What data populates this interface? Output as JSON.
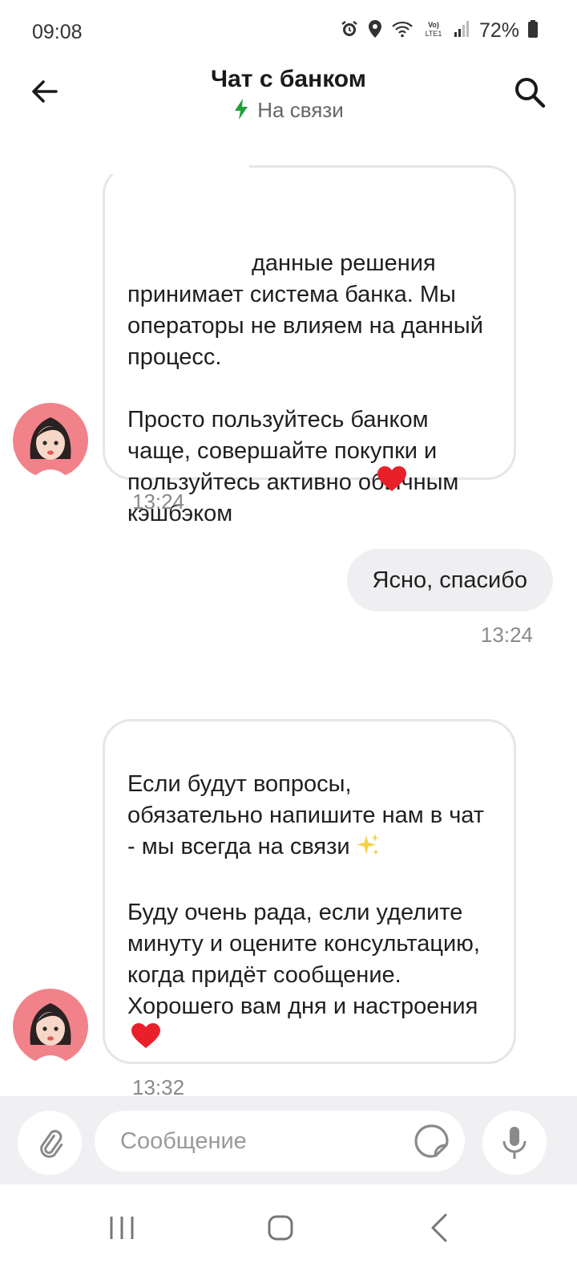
{
  "status_bar": {
    "time": "09:08",
    "network_label": "Vo) LTE1",
    "battery_percent": "72%",
    "icons": [
      "alarm-icon",
      "location-icon",
      "wifi-icon",
      "volte-icon",
      "signal-icon",
      "battery-icon"
    ]
  },
  "header": {
    "title": "Чат с банком",
    "status": "На связи",
    "status_color": "#21a038",
    "icons": [
      "arrow-back-icon",
      "search-icon",
      "bolt-icon"
    ]
  },
  "messages": [
    {
      "direction": "incoming",
      "text": "данные решения принимает система банка. Мы операторы не влияем на данный процесс.\n\nПросто пользуйтесь банком чаще, совершайте покупки и пользуйтесь активно обычным кэшбэком",
      "emoji": "heart-icon",
      "time": "13:24"
    },
    {
      "direction": "outgoing",
      "text": "Ясно, спасибо",
      "time": "13:24"
    },
    {
      "direction": "incoming",
      "text_part1": "Если будут вопросы, обязательно напишите нам в чат - мы всегда на связи",
      "emoji1": "sparkles-icon",
      "text_part2": "\n\nБуду очень рада, если уделите минуту и оцените консультацию, когда придёт сообщение.\nХорошего вам дня и настроения",
      "emoji2": "heart-icon",
      "time": "13:32"
    }
  ],
  "composer": {
    "placeholder": "Сообщение",
    "value": "",
    "icons": [
      "paperclip-icon",
      "sticker-icon",
      "microphone-icon"
    ]
  },
  "nav_bar": {
    "icons": [
      "recent-apps-icon",
      "home-icon",
      "back-icon"
    ]
  },
  "colors": {
    "accent_green": "#21a038",
    "bubble_border": "#e6e6e6",
    "outgoing_bubble": "#efeff2",
    "heart": "#e8202a",
    "avatar_bg": "#f2828a"
  }
}
